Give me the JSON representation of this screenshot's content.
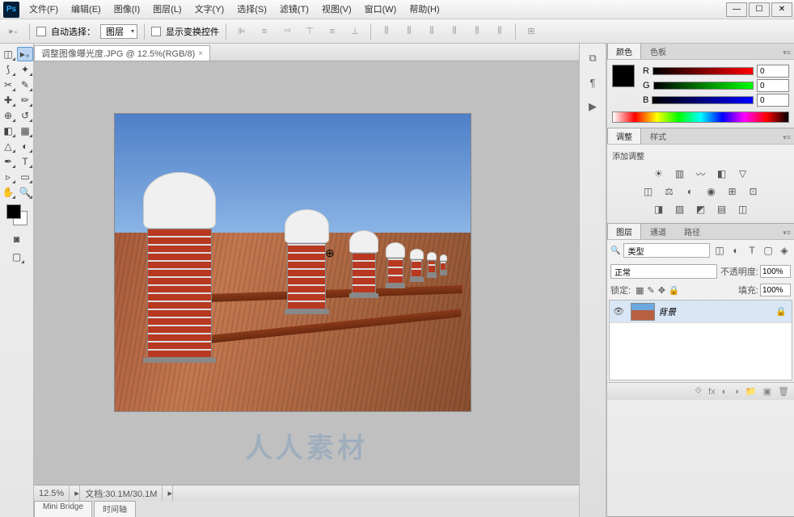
{
  "app": {
    "logo": "Ps"
  },
  "menu": {
    "file": "文件(F)",
    "edit": "编辑(E)",
    "image": "图像(I)",
    "layer": "图层(L)",
    "type": "文字(Y)",
    "select": "选择(S)",
    "filter": "滤镜(T)",
    "view": "视图(V)",
    "window": "窗口(W)",
    "help": "帮助(H)"
  },
  "win_controls": {
    "min": "—",
    "max": "☐",
    "close": "✕"
  },
  "options": {
    "auto_select": "自动选择：",
    "auto_select_target": "图层",
    "show_transform": "显示变换控件"
  },
  "document": {
    "tab_title": "调整图像曝光度.JPG @ 12.5%(RGB/8)",
    "zoom": "12.5%",
    "doc_info": "文档:30.1M/30.1M"
  },
  "bottom_tabs": {
    "mini_bridge": "Mini Bridge",
    "timeline": "时间轴"
  },
  "panels": {
    "color": {
      "tab_color": "颜色",
      "tab_swatches": "色板",
      "r_label": "R",
      "g_label": "G",
      "b_label": "B",
      "r_val": "0",
      "g_val": "0",
      "b_val": "0"
    },
    "adjustments": {
      "tab_adjust": "调整",
      "tab_styles": "样式",
      "add_adjust": "添加调整"
    },
    "layers": {
      "tab_layers": "图层",
      "tab_channels": "通道",
      "tab_paths": "路径",
      "filter_kind": "类型",
      "blend_mode": "正常",
      "opacity_label": "不透明度:",
      "opacity_val": "100%",
      "lock_label": "锁定:",
      "fill_label": "填充:",
      "fill_val": "100%",
      "bg_layer": "背景"
    }
  },
  "watermark": "人人素材"
}
